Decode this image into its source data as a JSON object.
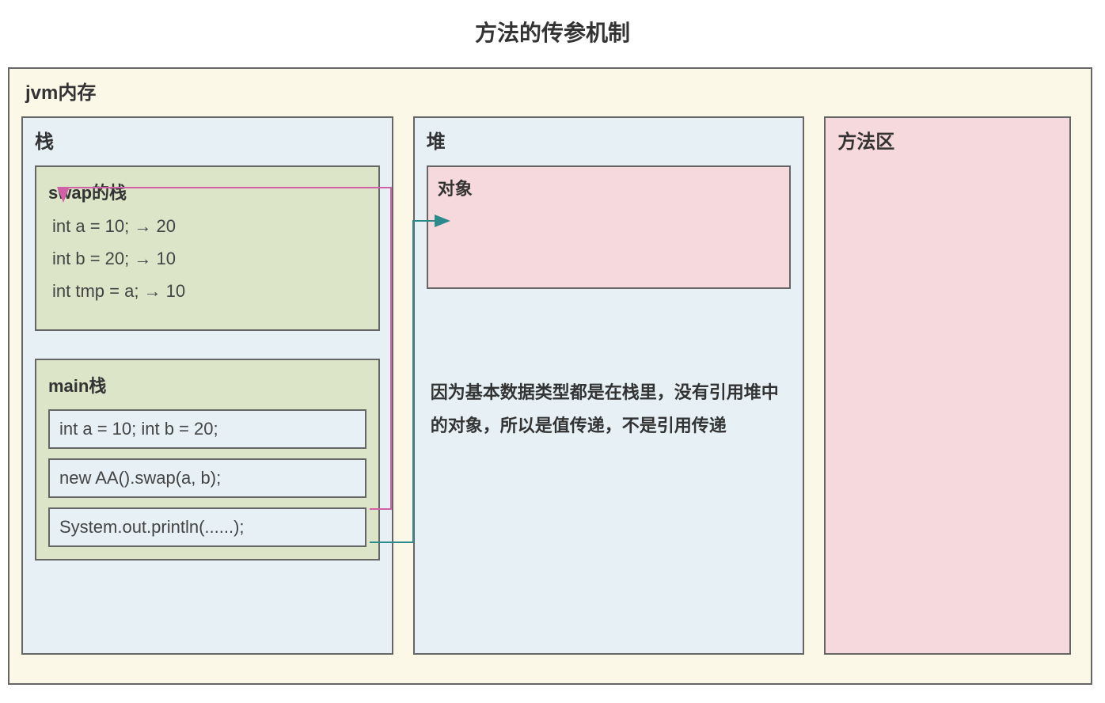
{
  "title": "方法的传参机制",
  "jvm": {
    "label": "jvm内存"
  },
  "stack": {
    "label": "栈",
    "swapFrame": {
      "label": "swap的栈",
      "lines": [
        "int a = 10; → 20",
        "int b = 20; → 10",
        "int tmp = a; → 10"
      ]
    },
    "mainFrame": {
      "label": "main栈",
      "lines": [
        "int a = 10;    int b = 20;",
        "new AA().swap(a, b);",
        "System.out.println(......);"
      ]
    }
  },
  "heap": {
    "label": "堆",
    "object": {
      "label": "对象"
    },
    "explanation": "因为基本数据类型都是在栈里，没有引用堆中的对象，所以是值传递，不是引用传递"
  },
  "methodArea": {
    "label": "方法区"
  }
}
